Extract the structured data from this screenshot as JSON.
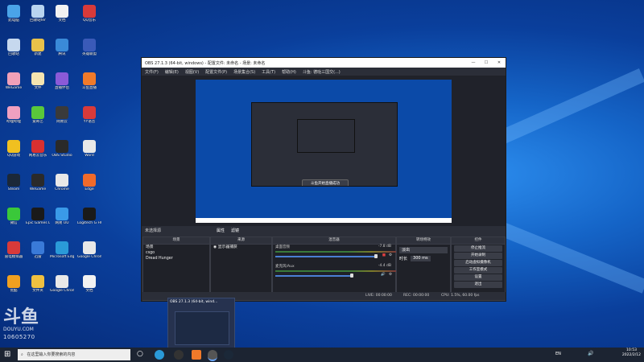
{
  "desktop": {
    "icons": [
      {
        "label": "此电脑",
        "color": "#4aa3e8"
      },
      {
        "label": "回收站fer",
        "color": "#b8d4f0"
      },
      {
        "label": "文档",
        "color": "#f2f2f2"
      },
      {
        "label": "QQ音乐",
        "color": "#d83a3a"
      },
      {
        "label": "回收站",
        "color": "#c6d8ee"
      },
      {
        "label": "新建",
        "color": "#e8c14a"
      },
      {
        "label": "腾讯",
        "color": "#3a8ad8"
      },
      {
        "label": "英雄联盟",
        "color": "#3a5ab8"
      },
      {
        "label": "WeGame",
        "color": "#f0a0b8"
      },
      {
        "label": "文件",
        "color": "#f4e4b0"
      },
      {
        "label": "直播伴侣",
        "color": "#8a5ad8"
      },
      {
        "label": "斗鱼直播",
        "color": "#f07a2a"
      },
      {
        "label": "哔哩哔哩",
        "color": "#f0a0c0"
      },
      {
        "label": "爱奇艺",
        "color": "#5ac83a"
      },
      {
        "label": "网易云",
        "color": "#3a3a3a"
      },
      {
        "label": "YY语音",
        "color": "#d83a3a"
      },
      {
        "label": "QQ游戏",
        "color": "#f0c020"
      },
      {
        "label": "网易云音乐",
        "color": "#d83030"
      },
      {
        "label": "OBS Studio",
        "color": "#2a2a2a"
      },
      {
        "label": "Word",
        "color": "#e8e8e8"
      },
      {
        "label": "Steam",
        "color": "#1b2838"
      },
      {
        "label": "WeGame",
        "color": "#2a2a2a"
      },
      {
        "label": "Chrome",
        "color": "#e8e8e8"
      },
      {
        "label": "Edge",
        "color": "#f06a2a"
      },
      {
        "label": "微信",
        "color": "#3ac83a"
      },
      {
        "label": "Epic Games Launcher",
        "color": "#1a1a1a"
      },
      {
        "label": "网易 UU",
        "color": "#3a9ae8"
      },
      {
        "label": "Logitech G HUB",
        "color": "#1a1a1a"
      },
      {
        "label": "雷电模拟器",
        "color": "#d83a3a"
      },
      {
        "label": "迅雷",
        "color": "#3a7ad8"
      },
      {
        "label": "Microsoft Edge",
        "color": "#2a9ad8"
      },
      {
        "label": "Google Chrome",
        "color": "#e8e8e8"
      },
      {
        "label": "优酷",
        "color": "#f0a020"
      },
      {
        "label": "文件夹",
        "color": "#f0c040"
      },
      {
        "label": "Google Chrome",
        "color": "#e8e8e8"
      },
      {
        "label": "文档",
        "color": "#f2f2f2"
      }
    ]
  },
  "obs": {
    "title": "OBS 27.1.3 (64-bit, windows) - 配置文件: 未命名 - 场景: 未命名",
    "menu": [
      "文件(F)",
      "编辑(E)",
      "视图(V)",
      "配置文件(P)",
      "场景集合(S)",
      "工具(T)",
      "帮助(H)",
      "斗鱼: 德哒三国交(...)"
    ],
    "toast": "斗鱼开始直播成功",
    "no_source": "未选择源",
    "scene_tabs": [
      "属性",
      "滤镜"
    ],
    "panels": {
      "scenes": {
        "title": "场景",
        "items": [
          "场景",
          "csgo",
          "Dread Hunger"
        ],
        "foot": "+ — ∧ ∨"
      },
      "sources": {
        "title": "来源",
        "items": [
          "显示器捕获"
        ],
        "foot": "+ — ⚙ ∧ ∨"
      },
      "mixer": {
        "title": "混音器",
        "tracks": [
          {
            "name": "桌面音频",
            "db": "-7.8 dB"
          },
          {
            "name": "麦克风/Aux",
            "db": "-4.4 dB"
          }
        ]
      },
      "transitions": {
        "title": "转场特效",
        "mode": "淡出",
        "duration_label": "时长",
        "duration": "300 ms"
      },
      "controls": {
        "title": "控件",
        "buttons": [
          "停止推流",
          "开始录制",
          "启动虚拟摄像机",
          "工作室模式",
          "设置",
          "退出"
        ]
      }
    },
    "status": {
      "live": "LIVE: 00:00:00",
      "rec": "REC: 00:00:00",
      "cpu": "CPU: 1.5%, 60.00 fps"
    }
  },
  "taskbar": {
    "search_placeholder": "在这里输入你要搜索的内容",
    "thumb_title": "OBS 27.1.3 (64-bit, wind...",
    "time": "10:53",
    "date": "2022/2/12",
    "ime": "EN"
  },
  "watermark": {
    "logo": "斗鱼",
    "site": "DOUYU.COM",
    "room": "10605270"
  }
}
